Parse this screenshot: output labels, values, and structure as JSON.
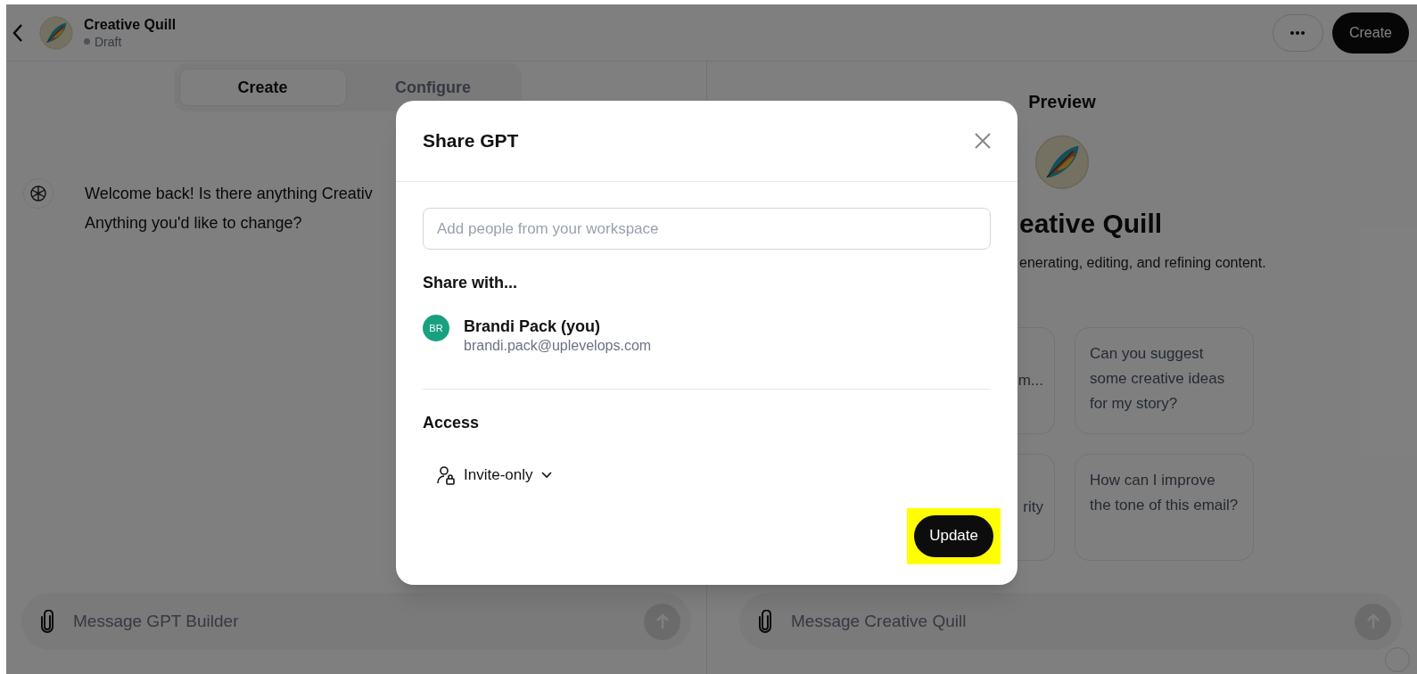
{
  "header": {
    "title": "Creative Quill",
    "status": "Draft",
    "create_button": "Create"
  },
  "builder": {
    "tabs": [
      {
        "label": "Create",
        "selected": true
      },
      {
        "label": "Configure",
        "selected": false
      }
    ],
    "message_lines": [
      "Welcome back! Is there anything Creativ",
      "Anything you'd like to change?"
    ],
    "composer_placeholder": "Message GPT Builder"
  },
  "preview": {
    "heading": "Preview",
    "name": "eative Quill",
    "description": "enerating, editing, and refining content.",
    "starters": [
      {
        "kind": "partial",
        "text": "m..."
      },
      {
        "kind": "full",
        "text": "Can you suggest some creative ideas for my story?"
      },
      {
        "kind": "partial",
        "text": "rity"
      },
      {
        "kind": "full",
        "text": "How can I improve the tone of this email?"
      }
    ],
    "composer_placeholder": "Message Creative Quill"
  },
  "modal": {
    "title": "Share GPT",
    "input_placeholder": "Add people from your workspace",
    "share_heading": "Share with...",
    "people": [
      {
        "initials": "BR",
        "name": "Brandi Pack (you)",
        "email": "brandi.pack@uplevelops.com",
        "color": "#19a17f"
      }
    ],
    "access_heading": "Access",
    "access_value": "Invite-only",
    "update_button": {
      "label": "Update",
      "highlighted": true
    }
  }
}
